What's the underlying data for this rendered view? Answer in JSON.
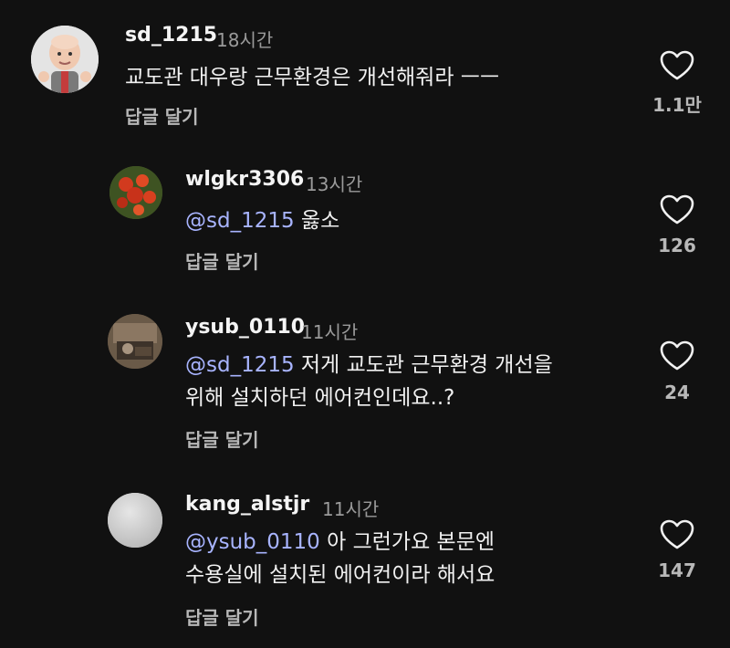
{
  "comments": [
    {
      "username": "sd_1215",
      "time": "18시간",
      "mention": "",
      "text_line1": "교도관 대우랑 근무환경은 개선해줘라 ㅡㅡ",
      "text_line2": "",
      "reply_label": "답글 달기",
      "likes": "1.1만",
      "avatar": "3d-character-avatar"
    },
    {
      "username": "wlgkr3306",
      "time": "13시간",
      "mention": "@sd_1215",
      "text_line1": " 옳소",
      "text_line2": "",
      "reply_label": "답글 달기",
      "likes": "126",
      "avatar": "red-flowers-avatar"
    },
    {
      "username": "ysub_0110",
      "time": "11시간",
      "mention": "@sd_1215",
      "text_line1": " 저게 교도관 근무환경 개선을",
      "text_line2": "위해 설치하던 에어컨인데요..?",
      "reply_label": "답글 달기",
      "likes": "24",
      "avatar": "photo-avatar"
    },
    {
      "username": "kang_alstjr",
      "time": "11시간",
      "mention": "@ysub_0110",
      "text_line1": " 아 그런가요 본문엔",
      "text_line2": "수용실에 설치된 에어컨이라 해서요",
      "reply_label": "답글 달기",
      "likes": "147",
      "avatar": "default-avatar"
    }
  ],
  "colors": {
    "background": "#111111",
    "mention": "#a8b4ff",
    "secondary_text": "#9a9a9a"
  }
}
